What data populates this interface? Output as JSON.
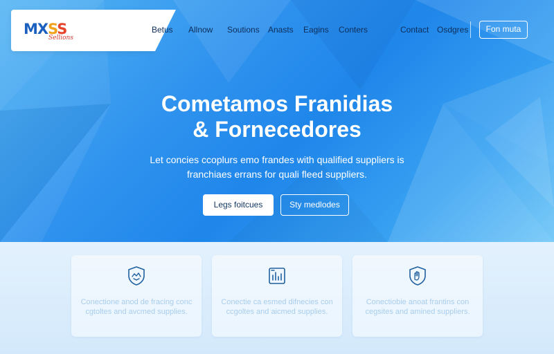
{
  "brand": {
    "logo_part1": "MX",
    "logo_part2": "S",
    "logo_part3": "S",
    "logo_sub": "Sellions",
    "colors": {
      "blue": "#1b5fbf",
      "orange": "#f2a21a",
      "red": "#e6452c"
    }
  },
  "nav": {
    "links": [
      "Betus",
      "Allnow",
      "Soutions",
      "Anasts",
      "Eagins",
      "Conters"
    ],
    "right_links": [
      "Contact",
      "Osdgres"
    ],
    "cta_label": "Fon muta"
  },
  "hero": {
    "title_line1": "Cometamos Franidias",
    "title_line2": "& Fornecedores",
    "subtitle_line1": "Let concies ccoplurs emo frandes with qualified suppliers is",
    "subtitle_line2": "franchiaes errans for quali fleed suppliers.",
    "primary_button": "Legs foitcues",
    "secondary_button": "Sty medlodes",
    "colors": {
      "accent": "#2f92ee",
      "text": "#ffffff"
    }
  },
  "features": [
    {
      "icon": "shield-badge-icon",
      "text": "Conectione anod de fracing conc cgtoltes and avcmed supplies."
    },
    {
      "icon": "document-chart-icon",
      "text": "Conectie ca esmed difnecies con ccgoltes and aicmed supplies."
    },
    {
      "icon": "hand-badge-icon",
      "text": "Conectiobie anoat frantins con cegsites and amined suppliers."
    }
  ]
}
